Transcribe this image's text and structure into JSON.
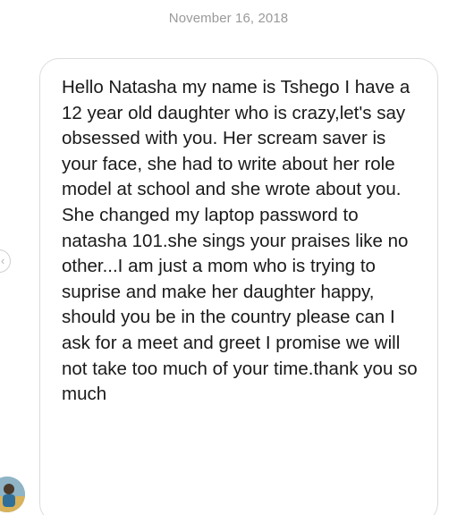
{
  "thread": {
    "date_header": "November 16, 2018"
  },
  "message": {
    "text": "Hello Natasha my name is Tshego I have a 12 year old daughter who is crazy,let's say obsessed with you. Her scream saver is your face, she had to write about her role model at school and she wrote about you. She changed my laptop password to natasha 101.she sings your praises like no other...I am just a mom who is trying to suprise and make her daughter happy, should you be in the country please can I ask for a meet and greet I promise we will not take too much of your time.thank you so much"
  },
  "icons": {
    "nav": "chevron-left-icon",
    "avatar": "user-avatar"
  },
  "colors": {
    "date_text": "#9a9a9a",
    "bubble_border": "#dcdcdc",
    "message_text": "#1a1a1a"
  }
}
